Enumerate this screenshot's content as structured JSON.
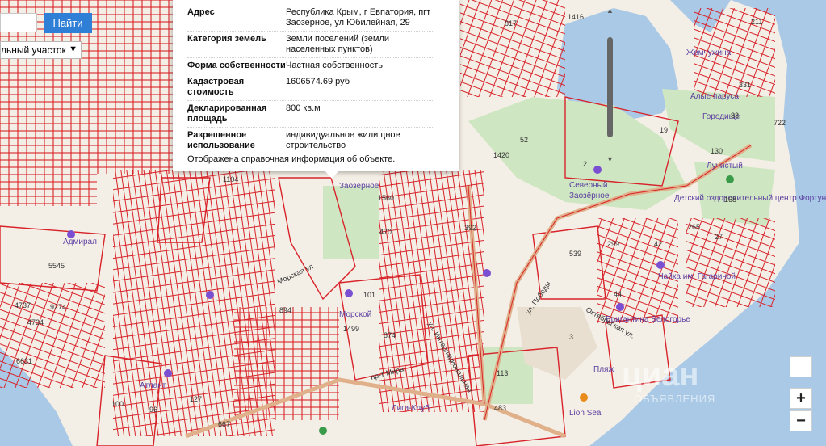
{
  "search": {
    "button_label": "Найти"
  },
  "layer_select": {
    "value": "льный участок"
  },
  "popup": {
    "rows": [
      {
        "key": "Адрес",
        "value": "Республика Крым, г Евпатория, пгт Заозерное, ул Юбилейная, 29"
      },
      {
        "key": "Категория земель",
        "value": "Земли поселений (земли населенных пунктов)"
      },
      {
        "key": "Форма собственности",
        "value": "Частная собственность"
      },
      {
        "key": "Кадастровая стоимость",
        "value": "1606574.69 руб"
      },
      {
        "key": "Декларированная площадь",
        "value": "800 кв.м"
      },
      {
        "key": "Разрешенное использование",
        "value": "индивидуальное жилищное строительство"
      }
    ],
    "note": "Отображена справочная информация об объекте."
  },
  "controls": {
    "zoom_in": "+",
    "zoom_out": "−"
  },
  "watermark": {
    "brand": "циан",
    "sub": "ОБЪЯВЛЕНИЯ"
  },
  "colors": {
    "parcel": "#d8232a",
    "water": "#a9c9e6",
    "park": "#cfe6c2",
    "land": "#f4efe6"
  },
  "map": {
    "places": [
      "Адмирал",
      "Морской",
      "Лига-Клуб",
      "Атлант",
      "Lion Sea",
      "Северный",
      "Заозёрное",
      "Бригантина Белогорье",
      "Чайка им. Гагариной",
      "Детский оздоровительный центр Фортуна",
      "Лучистый",
      "Городище",
      "Алые паруса",
      "Жемчужина",
      "Заозерное",
      "Пляж"
    ],
    "numbers": [
      "1416",
      "817",
      "211",
      "331",
      "83",
      "19",
      "130",
      "168",
      "27",
      "265",
      "42",
      "539",
      "299",
      "2",
      "52",
      "1420",
      "1104",
      "470",
      "101",
      "874",
      "894",
      "1499",
      "113",
      "483",
      "667",
      "5545",
      "9274",
      "4737",
      "4734",
      "6631",
      "100",
      "96",
      "127",
      "3",
      "722",
      "1560",
      "392",
      "44"
    ],
    "streets": [
      "ул. Победы",
      "Октябрьская ул.",
      "Морская ул.",
      "ул. Интернациональная",
      "пр-т Мира"
    ]
  }
}
